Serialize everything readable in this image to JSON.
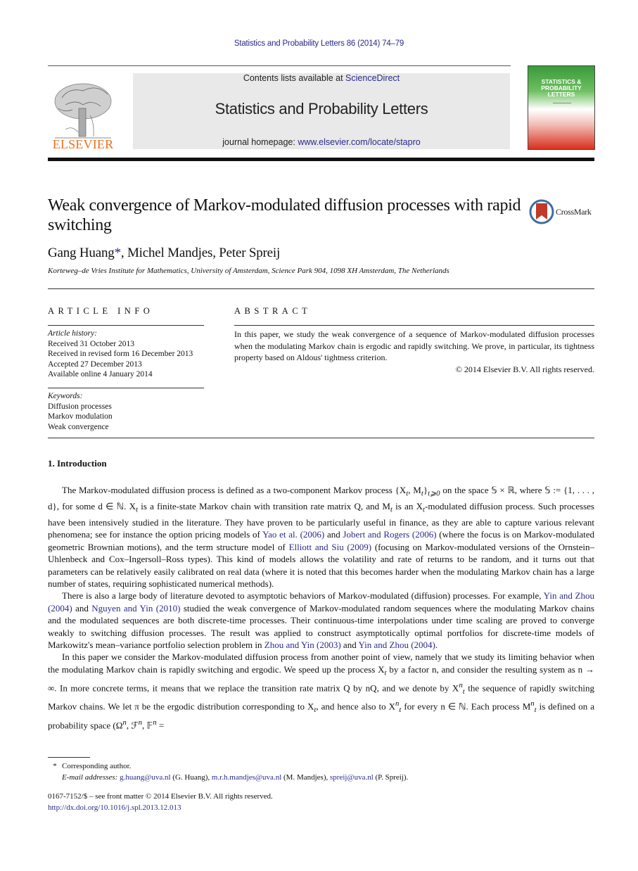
{
  "running_header": "Statistics and Probability Letters 86 (2014) 74–79",
  "banner": {
    "contents_prefix": "Contents lists available at ",
    "contents_link": "ScienceDirect",
    "journal_title": "Statistics and Probability Letters",
    "homepage_prefix": "journal homepage: ",
    "homepage_link": "www.elsevier.com/locate/stapro"
  },
  "publisher_logo_text": "ELSEVIER",
  "cover": {
    "title_lines": [
      "STATISTICS &",
      "PROBABILITY",
      "LETTERS"
    ]
  },
  "crossmark_label": "CrossMark",
  "article": {
    "title": "Weak convergence of Markov-modulated diffusion processes with rapid switching",
    "authors": [
      {
        "name": "Gang Huang",
        "mark": "*"
      },
      {
        "name": "Michel Mandjes",
        "mark": ""
      },
      {
        "name": "Peter Spreij",
        "mark": ""
      }
    ],
    "affiliation": "Korteweg–de Vries Institute for Mathematics, University of Amsterdam, Science Park 904, 1098 XH Amsterdam, The Netherlands"
  },
  "article_info": {
    "heading": "ARTICLE INFO",
    "history_label": "Article history:",
    "history": [
      "Received 31 October 2013",
      "Received in revised form 16 December 2013",
      "Accepted 27 December 2013",
      "Available online 4 January 2014"
    ],
    "keywords_label": "Keywords:",
    "keywords": [
      "Diffusion processes",
      "Markov modulation",
      "Weak convergence"
    ]
  },
  "abstract": {
    "heading": "ABSTRACT",
    "text": "In this paper, we study the weak convergence of a sequence of Markov-modulated diffusion processes when the modulating Markov chain is ergodic and rapidly switching. We prove, in particular, its tightness property based on Aldous' tightness criterion.",
    "copyright": "© 2014 Elsevier B.V. All rights reserved."
  },
  "section": {
    "heading": "1.  Introduction",
    "p1": {
      "a": "The Markov-modulated diffusion process is defined as a two-component Markov process {X",
      "b": ", M",
      "c": "}",
      "d": " on the space 𝕊 × ℝ, where 𝕊 := {1, . . . , d}, for some d ∈ ℕ. X",
      "e": " is a finite-state Markov chain with transition rate matrix Q, and M",
      "f": " is an X",
      "g": "-modulated diffusion process. Such processes have been intensively studied in the literature. They have proven to be particularly useful in finance, as they are able to capture various relevant phenomena; see for instance the option pricing models of ",
      "ref1": "Yao et al. (2006)",
      "h": " and ",
      "ref2": "Jobert and Rogers (2006)",
      "i": " (where the focus is on Markov-modulated geometric Brownian motions), and the term structure model of ",
      "ref3": "Elliott and Siu (2009)",
      "j": " (focusing on Markov-modulated versions of the Ornstein–Uhlenbeck and Cox–Ingersoll–Ross types). This kind of models allows the volatility and rate of returns to be random, and it turns out that parameters can be relatively easily calibrated on real data (where it is noted that this becomes harder when the modulating Markov chain has a large number of states, requiring sophisticated numerical methods)."
    },
    "p2": {
      "a": "There is also a large body of literature devoted to asymptotic behaviors of Markov-modulated (diffusion) processes. For example, ",
      "ref1": "Yin and Zhou (2004)",
      "b": " and ",
      "ref2": "Nguyen and Yin (2010)",
      "c": " studied the weak convergence of Markov-modulated random sequences where the modulating Markov chains and the modulated sequences are both discrete-time processes. Their continuous-time interpolations under time scaling are proved to converge weakly to switching diffusion processes. The result was applied to construct asymptotically optimal portfolios for discrete-time models of Markowitz's mean–variance portfolio selection problem in ",
      "ref3": "Zhou and Yin (2003)",
      "d": " and ",
      "ref4": "Yin and Zhou (2004)",
      "e": "."
    },
    "p3": {
      "a": "In this paper we consider the Markov-modulated diffusion process from another point of view, namely that we study its limiting behavior when the modulating Markov chain is rapidly switching and ergodic. We speed up the process X",
      "b": " by a factor n, and consider the resulting system as n → ∞. In more concrete terms, it means that we replace the transition rate matrix Q by nQ, and we denote by X",
      "c": " the sequence of rapidly switching Markov chains. We let π be the ergodic distribution corresponding to X",
      "d": ", and hence also to X",
      "e": " for every n ∈ ℕ. Each process M",
      "f": " is defined on a probability space (Ω",
      "g": ", ℱ",
      "h": ", 𝔽",
      "i": " ="
    }
  },
  "footnote": {
    "star": "*",
    "corresponding": "Corresponding author.",
    "email_label": "E-mail addresses:",
    "emails": [
      {
        "addr": "g.huang@uva.nl",
        "who": "(G. Huang)"
      },
      {
        "addr": "m.r.h.mandjes@uva.nl",
        "who": "(M. Mandjes)"
      },
      {
        "addr": "spreij@uva.nl",
        "who": "(P. Spreij)."
      }
    ]
  },
  "issn_line": "0167-7152/$ – see front matter © 2014 Elsevier B.V. All rights reserved.",
  "doi": "http://dx.doi.org/10.1016/j.spl.2013.12.013",
  "colors": {
    "link": "#2a2a8a",
    "elsevier_orange": "#e8731e",
    "banner_bg": "#e9e9e9"
  }
}
